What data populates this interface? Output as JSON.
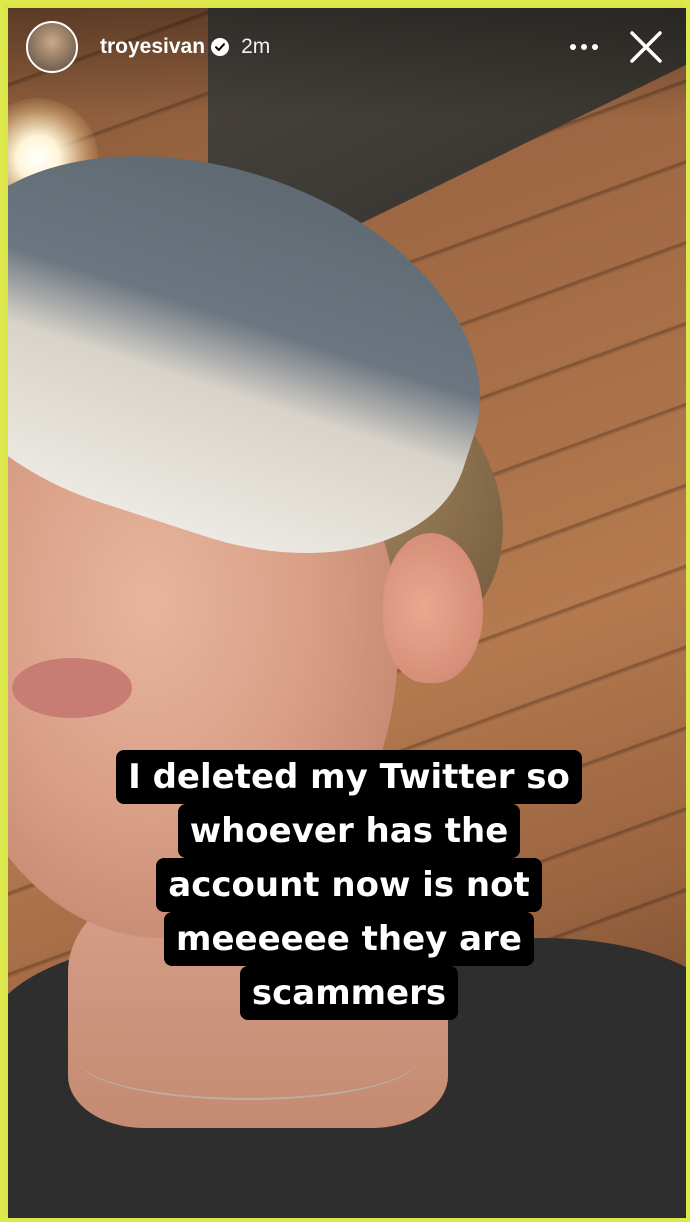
{
  "story": {
    "user": {
      "username": "troyesivan",
      "verified": true,
      "time_ago": "2m"
    },
    "actions": {
      "more_icon": "more-horizontal-icon",
      "close_icon": "close-icon"
    },
    "caption_lines": [
      "I deleted my Twitter so",
      "whoever has the",
      "account now is not",
      "meeeeee they are",
      "scammers"
    ],
    "colors": {
      "frame": "#dfe84c",
      "caption_bg": "#000000",
      "caption_text": "#ffffff"
    }
  }
}
